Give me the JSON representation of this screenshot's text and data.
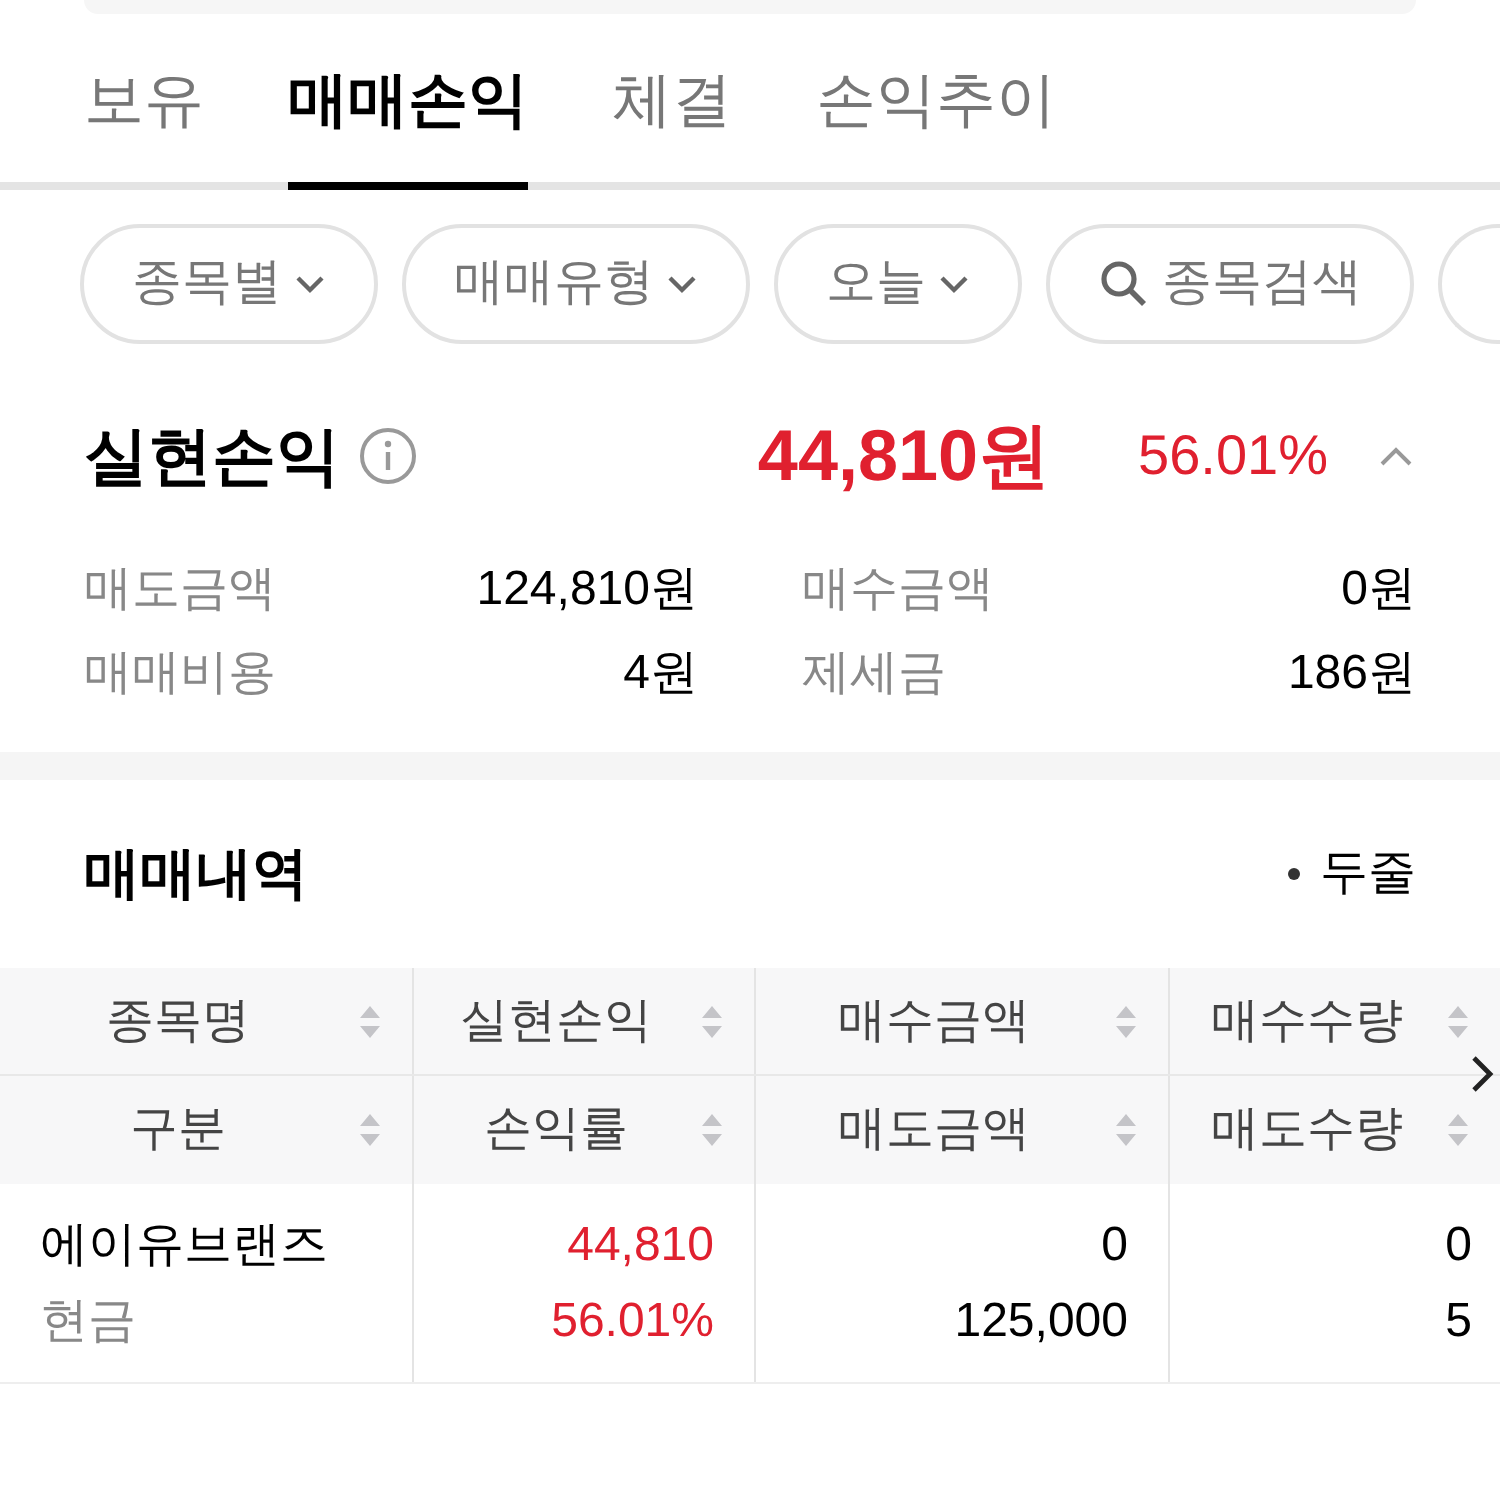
{
  "tabs": [
    {
      "label": "보유",
      "selected": false
    },
    {
      "label": "매매손익",
      "selected": true
    },
    {
      "label": "체결",
      "selected": false
    },
    {
      "label": "손익추이",
      "selected": false
    }
  ],
  "filters": [
    {
      "kind": "dropdown",
      "label": "종목별"
    },
    {
      "kind": "dropdown",
      "label": "매매유형"
    },
    {
      "kind": "dropdown",
      "label": "오늘"
    },
    {
      "kind": "search",
      "label": "종목검색"
    }
  ],
  "summary": {
    "title": "실현손익",
    "amount": "44,810원",
    "rate": "56.01%",
    "gain": true,
    "expanded": true,
    "metrics": [
      {
        "label": "매도금액",
        "value": "124,810원"
      },
      {
        "label": "매수금액",
        "value": "0원"
      },
      {
        "label": "매매비용",
        "value": "4원"
      },
      {
        "label": "제세금",
        "value": "186원"
      }
    ]
  },
  "history": {
    "title": "매매내역",
    "view_toggle": "두줄",
    "columns": [
      {
        "top": "종목명",
        "bottom": "구분"
      },
      {
        "top": "실현손익",
        "bottom": "손익률"
      },
      {
        "top": "매수금액",
        "bottom": "매도금액"
      },
      {
        "top": "매수수량",
        "bottom": "매도수량"
      }
    ],
    "rows": [
      {
        "name": "에이유브랜즈",
        "type": "현금",
        "pnl": "44,810",
        "rate": "56.01%",
        "gain": true,
        "buy_amount": "0",
        "sell_amount": "125,000",
        "buy_qty": "0",
        "sell_qty": "5"
      }
    ]
  }
}
